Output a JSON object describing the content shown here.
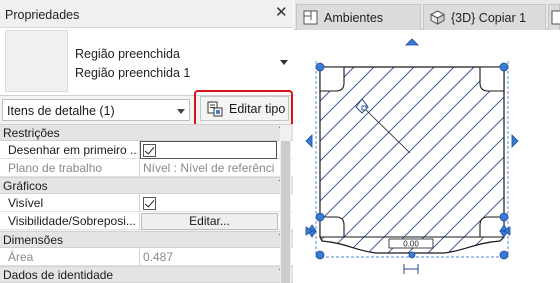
{
  "properties_panel": {
    "title": "Propriedades",
    "close_glyph": "✕",
    "type_selector": {
      "family": "Região preenchida",
      "type": "Região preenchida 1"
    },
    "filter": {
      "selected": "Itens de detalhe (1)"
    },
    "edit_type_button": {
      "label": "Editar tipo",
      "icon": "edit-type-icon"
    },
    "sections": [
      {
        "title": "Restrições",
        "rows": [
          {
            "label": "Desenhar em primeiro ...",
            "value": "",
            "kind": "checkbox",
            "checked": true
          },
          {
            "label": "Plano de trabalho",
            "value": "Nível : Nível de referência",
            "kind": "readonly"
          }
        ]
      },
      {
        "title": "Gráficos",
        "rows": [
          {
            "label": "Visível",
            "value": "",
            "kind": "checkbox",
            "checked": true
          },
          {
            "label": "Visibilidade/Sobreposi...",
            "value": "Editar...",
            "kind": "button"
          }
        ]
      },
      {
        "title": "Dimensões",
        "rows": [
          {
            "label": "Área",
            "value": "0.487",
            "kind": "readonly"
          }
        ]
      },
      {
        "title": "Dados de identidade",
        "rows": []
      }
    ],
    "collapse_glyph": "⌃"
  },
  "tabs": [
    {
      "label": "Ambientes",
      "icon": "floor-plan-icon"
    },
    {
      "label": "{3D} Copiar 1",
      "icon": "3d-box-icon"
    }
  ],
  "canvas": {
    "dimension_label": "0.00",
    "colors": {
      "hatch": "#2a4a8a",
      "grip": "#3a7bd5",
      "highlight": "#d8141b"
    }
  }
}
